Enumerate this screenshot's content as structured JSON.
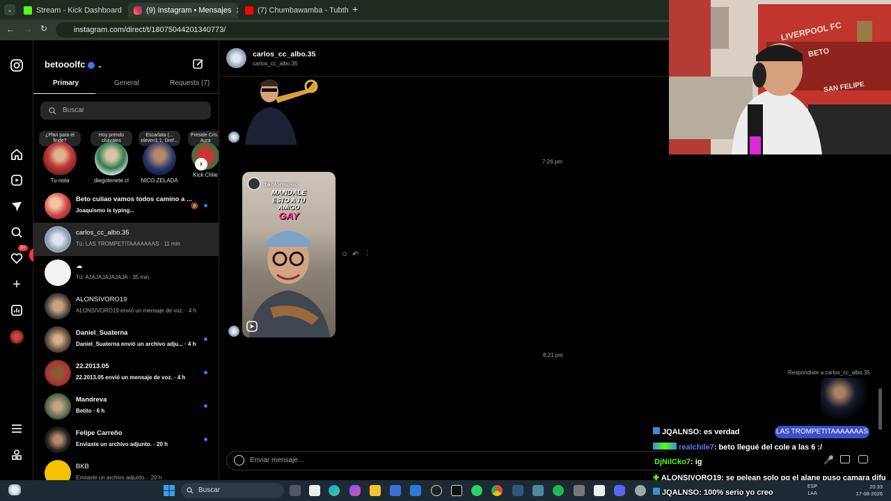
{
  "browser": {
    "tabs": [
      {
        "label": "Stream - Kick Dashboard",
        "color": "#53fc18"
      },
      {
        "label": "(9) Instagram • Mensajes",
        "color": "#e1306c"
      },
      {
        "label": "(7) Chumbawamba - Tubthump",
        "color": "#ff0000"
      }
    ],
    "url": "instagram.com/direct/t/18075044201340773/"
  },
  "inbox": {
    "username": "betooolfc",
    "tabs": [
      "Primary",
      "General",
      "Requests (7)"
    ],
    "search_placeholder": "Buscar",
    "notes": [
      {
        "bubble": "¿Plan para el finde?",
        "name": "Tu nota"
      },
      {
        "bubble": "Hoy prendo chavales",
        "name": "diegotenete.cl"
      },
      {
        "bubble": "Escarlata (... eleven1.1, Dref...",
        "name": "NICO ZELADA"
      },
      {
        "bubble": "Preside Cris I Aura",
        "name": "Kick Chile"
      }
    ],
    "conversations": [
      {
        "name": "Beto culiao vamos todos camino a ...",
        "msg": "Joaquismo is typing...",
        "unread": true,
        "muted": true
      },
      {
        "name": "carlos_cc_albo.35",
        "msg": "Tú: LAS TROMPETITAAAAAAAS · 11 min",
        "unread": false
      },
      {
        "name": "☁",
        "msg": "Tú: AJAJAJAJAJAJA · 35 min",
        "unread": false
      },
      {
        "name": "ALONSIVORO19",
        "msg": "ALONSIVORO19 envió un mensaje de voz. · 4 h",
        "unread": false
      },
      {
        "name": "Daniel_Suaterna",
        "msg": "Daniel_Suaterna envió un archivo adju... · 4 h",
        "unread": true
      },
      {
        "name": "22.2013.05",
        "msg": "22.2013.05 envió un mensaje de voz. · 4 h",
        "unread": true
      },
      {
        "name": "Mandreva",
        "msg": "Betito · 6 h",
        "unread": true
      },
      {
        "name": "Felipe Carreño",
        "msg": "Enviaste un archivo adjunto. · 20 h",
        "unread": true
      },
      {
        "name": "BKB",
        "msg": "Enviaste un archivo adjunto. · 20 h",
        "unread": false
      }
    ],
    "notif_badge": "14",
    "nav_badge": "9+"
  },
  "chat": {
    "contact_name": "carlos_cc_albo.35",
    "contact_handle": "carlos_cc_albo.35",
    "time1": "7:26 pm",
    "time2": "8:21 pm",
    "reel_user": "bkolormusic",
    "reel_caption_1": "MANDALE",
    "reel_caption_2": "ESTO A TU",
    "reel_caption_3": "AMIGO",
    "reel_caption_4": "GAY",
    "replied_to": "Respondiste a carlos_cc_albo.35",
    "input_placeholder": "Enviar mensaje..."
  },
  "webcam": {
    "sign_1": "LIVERPOOL FC",
    "sign_2": "BETO",
    "sign_3": "SAN FELIPE"
  },
  "stream_chat": [
    {
      "user": "JQALNSO",
      "text": ": es verdad"
    },
    {
      "user": "realchile7",
      "text": ": beto llegué del cole a las 6 :/"
    },
    {
      "user": "DjNilCko7",
      "text": ": ig"
    },
    {
      "user": "ALONSIVORO19",
      "text": ": se pelean solo pq el alane puso camara difu"
    },
    {
      "user": "JQALNSO",
      "text": ": 100% serio yo creo"
    }
  ],
  "stream_highlight": "LAS TROMPETITAAAAAAAS",
  "taskbar": {
    "search": "Buscar",
    "lang_1": "ESP",
    "lang_2": "LAA",
    "time": "20:33",
    "date": "17-08-2026"
  },
  "colors": {
    "accent": "#3d74ff",
    "kick": "#53fc18",
    "highlight": "#3b4fc9"
  }
}
